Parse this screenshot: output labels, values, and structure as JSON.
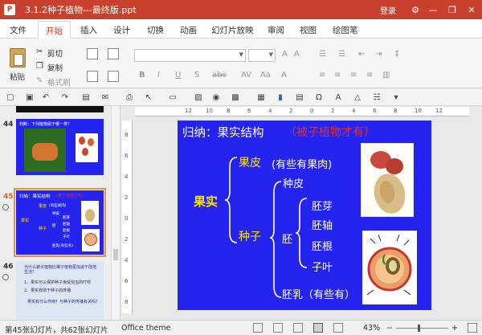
{
  "window": {
    "title": "3.1.2种子植物---最终版.ppt",
    "login": "登录",
    "controls": [
      "⚙",
      "—",
      "❐",
      "✕"
    ]
  },
  "ribbon_tabs": [
    "文件",
    "开始",
    "插入",
    "设计",
    "切换",
    "动画",
    "幻灯片放映",
    "审阅",
    "视图",
    "绘图笔"
  ],
  "active_tab": "开始",
  "clipboard": {
    "paste": "粘贴",
    "cut": "剪切",
    "copy": "复制",
    "format_painter": "格式刷"
  },
  "thumbnails": [
    {
      "number": "44",
      "title": "判断：下列植物属于哪一类？",
      "selected": false
    },
    {
      "number": "45",
      "title": "归纳：果实结构",
      "subtitle": "(被子植物才有)",
      "selected": true,
      "labels": [
        "果实",
        "果皮",
        "(有些果肉)",
        "种皮",
        "胚",
        "种子",
        "胚芽",
        "胚轴",
        "胚根",
        "子叶",
        "胚乳(有些有)"
      ]
    },
    {
      "number": "46",
      "selected": false,
      "lines": [
        "为什么被子植物比裸子植物更加适于陆地生活？",
        "1、果实可以保护种子免受昆虫的叮咬",
        "2、果实有助于种子的传播",
        "果实有什么作用？与种子的传播有关吗？"
      ]
    }
  ],
  "rulers": {
    "h": [
      "12",
      "10",
      "8",
      "6",
      "4",
      "2",
      "0",
      "2",
      "4",
      "6",
      "8",
      "10",
      "12"
    ],
    "v": [
      "8",
      "6",
      "4",
      "2",
      "0",
      "2",
      "4",
      "6",
      "8"
    ]
  },
  "slide": {
    "title": "归纳：果实结构",
    "subtitle": "（被子植物才有）",
    "fruit": "果实",
    "pericarp": "果皮",
    "pericarp_note": "(有些有果肉)",
    "seed_coat": "种皮",
    "seed": "种子",
    "embryo": "胚",
    "plumule": "胚芽",
    "hypocotyl": "胚轴",
    "radicle": "胚根",
    "cotyledon": "子叶",
    "endosperm": "胚乳（有些有）"
  },
  "status": {
    "slide_count": "第45张幻灯片，共62张幻灯片",
    "theme": "Office theme",
    "zoom": "43%"
  },
  "colors": {
    "titlebar": "#c9412c",
    "slide_bg": "#2424ee",
    "yellow": "#ffe300",
    "red": "#e03030"
  }
}
